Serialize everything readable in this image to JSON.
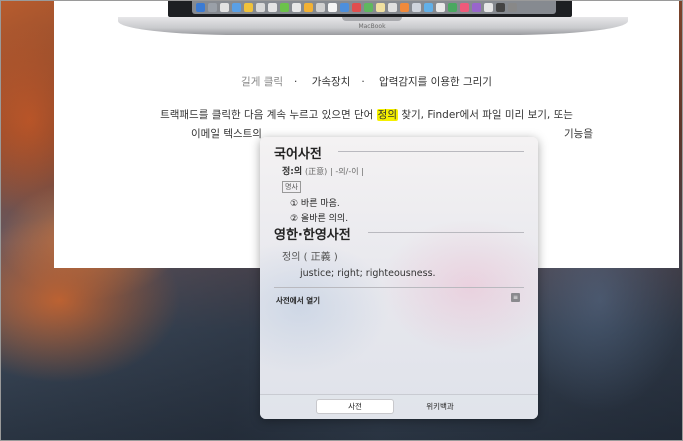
{
  "laptop_label": "MacBook",
  "topic_nav": [
    "길게 클릭",
    "가속장치",
    "압력감지를 이용한 그리기"
  ],
  "topic_nav_separator": "·",
  "paragraph": {
    "line1_before": "트랙패드를 클릭한 다음 계속 누르고 있으면 단어 ",
    "line1_highlight": "정의",
    "line1_after": " 찾기, Finder에서 파일 미리 보기, 또는",
    "line2": "이메일 텍스트의 ",
    "line2_end": " 기능을"
  },
  "dictionary": {
    "section1_title": "국어사전",
    "headword": "정:의",
    "hanja": "(正意)",
    "inflection": "| -의/-이 |",
    "pos": "명사",
    "definitions": [
      "① 바른 마음.",
      "② 올바른 의의."
    ],
    "section2_title": "영한·한영사전",
    "en_headword": "정의 ( 正義 )",
    "en_definition": "justice; right; righteousness.",
    "open_in_dictionary": "사전에서 열기",
    "tabs": [
      "사전",
      "위키백과"
    ]
  },
  "colors": {
    "highlight": "#f5f000",
    "card_bg": "#ffffff"
  }
}
